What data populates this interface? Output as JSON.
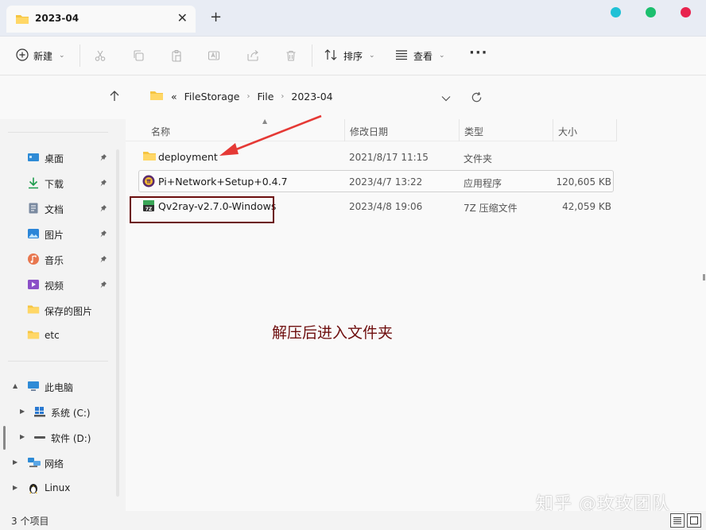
{
  "window": {
    "tab_title": "2023-04",
    "new_tab_symbol": "+",
    "close_symbol": "✕",
    "traffic_dots": [
      "#1fc1d6",
      "#1cbf6e",
      "#e8234e"
    ]
  },
  "toolbar": {
    "new_label": "新建",
    "sort_label": "排序",
    "view_label": "查看",
    "more_symbol": "···"
  },
  "address": {
    "prefix": "«",
    "crumbs": [
      "FileStorage",
      "File",
      "2023-04"
    ]
  },
  "nav": {
    "quick_access": [
      {
        "label": "桌面",
        "icon": "desktop-icon",
        "pinned": true
      },
      {
        "label": "下载",
        "icon": "download-icon",
        "pinned": true
      },
      {
        "label": "文档",
        "icon": "document-icon",
        "pinned": true
      },
      {
        "label": "图片",
        "icon": "pictures-icon",
        "pinned": true
      },
      {
        "label": "音乐",
        "icon": "music-icon",
        "pinned": true
      },
      {
        "label": "视频",
        "icon": "video-icon",
        "pinned": true
      },
      {
        "label": "保存的图片",
        "icon": "folder-icon",
        "pinned": false
      },
      {
        "label": "etc",
        "icon": "folder-icon",
        "pinned": false
      }
    ],
    "this_pc": "此电脑",
    "drives": [
      "系统 (C:)",
      "软件 (D:)"
    ],
    "network": "网络",
    "linux": "Linux"
  },
  "columns": {
    "name": "名称",
    "modified": "修改日期",
    "type": "类型",
    "size": "大小"
  },
  "files": [
    {
      "name": "deployment",
      "date": "2021/8/17 11:15",
      "type": "文件夹",
      "size": "",
      "icon": "folder-icon"
    },
    {
      "name": "Pi+Network+Setup+0.4.7",
      "date": "2023/4/7 13:22",
      "type": "应用程序",
      "size": "120,605 KB",
      "icon": "pi-app-icon"
    },
    {
      "name": "Qv2ray-v2.7.0-Windows",
      "date": "2023/4/8 19:06",
      "type": "7Z 压缩文件",
      "size": "42,059 KB",
      "icon": "7z-archive-icon"
    }
  ],
  "annotation": {
    "text": "解压后进入文件夹",
    "box_color": "#6b0d0d",
    "arrow_color": "#e53935"
  },
  "watermark": "知乎 @玫玫团队",
  "status": {
    "count": "3 个项目"
  }
}
